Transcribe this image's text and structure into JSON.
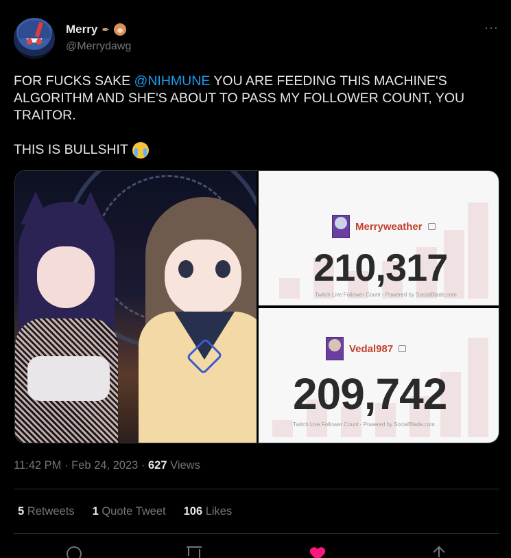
{
  "author": {
    "display_name": "Merry",
    "handle": "@Merrydawg",
    "badges": [
      "pen-emoji-icon",
      "dog-emoji-icon"
    ]
  },
  "more_label": "···",
  "tweet": {
    "line1_before": "FOR FUCKS SAKE ",
    "mention": "@NIHMUNE",
    "line1_after": " YOU ARE FEEDING THIS MACHINE'S ALGORITHM AND SHE'S ABOUT TO PASS MY FOLLOWER COUNT, YOU TRAITOR.",
    "line2": "THIS IS BULLSHIT",
    "emoji": "loudly-crying-face-icon"
  },
  "media": {
    "top": {
      "streamer": "Merryweather",
      "count": "210,317",
      "caption": "Twitch Live Follower Count - Powered by SocialBlade.com"
    },
    "bottom": {
      "streamer": "Vedal987",
      "count": "209,742",
      "caption": "Twitch Live Follower Count - Powered by SocialBlade.com"
    }
  },
  "meta": {
    "time": "11:42 PM",
    "sep1": " · ",
    "date": "Feb 24, 2023",
    "sep2": " · ",
    "views_count": "627",
    "views_label": " Views"
  },
  "stats": {
    "retweets_count": "5",
    "retweets_label": " Retweets",
    "quotes_count": "1",
    "quotes_label": " Quote Tweet",
    "likes_count": "106",
    "likes_label": " Likes"
  },
  "colors": {
    "background": "#000000",
    "text": "#e7e9ea",
    "muted": "#71767b",
    "link": "#1d9bf0",
    "like": "#f91880",
    "streamer_name": "#c2412d"
  }
}
